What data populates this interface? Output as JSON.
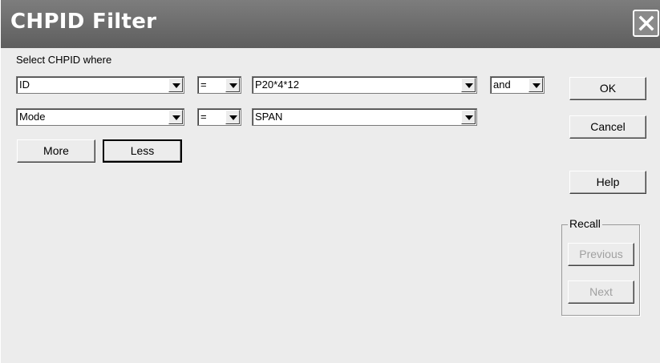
{
  "dialog": {
    "title": "CHPID Filter",
    "prompt": "Select CHPID where"
  },
  "rows": [
    {
      "field": "ID",
      "operator": "=",
      "value": "P20*4*12",
      "connector": "and"
    },
    {
      "field": "Mode",
      "operator": "=",
      "value": "SPAN"
    }
  ],
  "buttons": {
    "more": "More",
    "less": "Less",
    "ok": "OK",
    "cancel": "Cancel",
    "help": "Help"
  },
  "recall": {
    "label": "Recall",
    "previous": "Previous",
    "next": "Next"
  },
  "icons": {
    "close": "close-icon",
    "dropdown": "chevron-down-icon"
  },
  "colors": {
    "titlebar": "#6e6e6e",
    "dialog_bg": "#ececec",
    "disabled_text": "#a0a0a0"
  }
}
